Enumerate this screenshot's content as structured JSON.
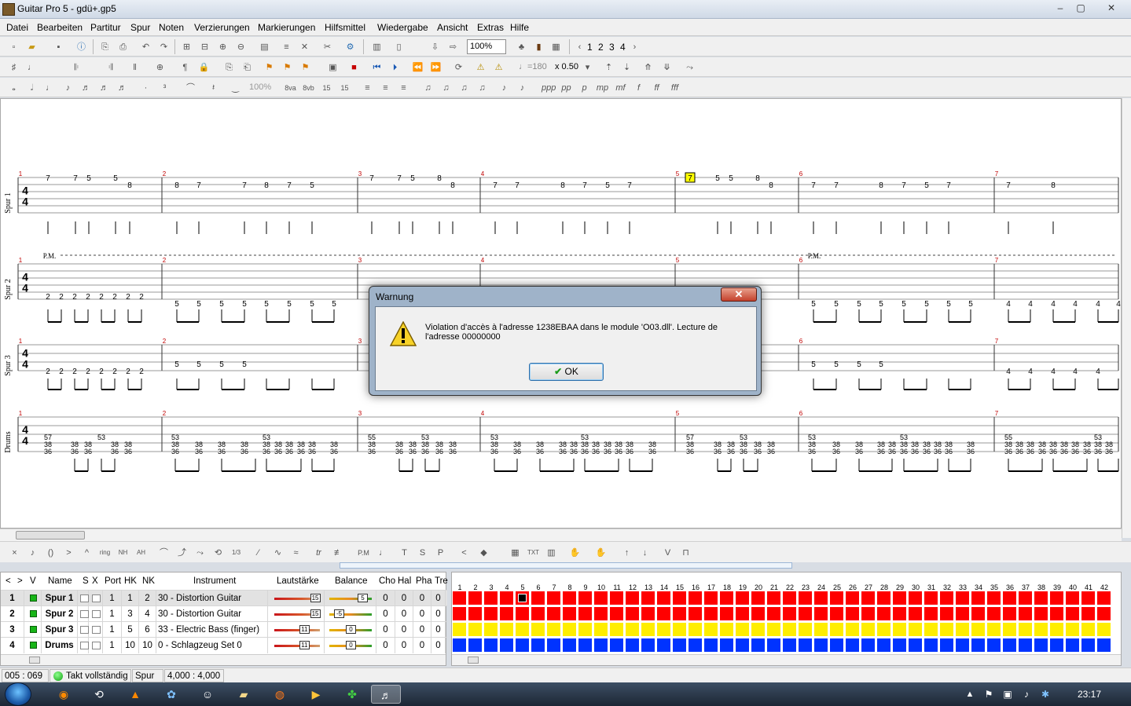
{
  "window": {
    "title": "Guitar Pro 5 - gdü+.gp5",
    "minimize": "–",
    "maximize": "▢",
    "close": "✕"
  },
  "menu": [
    "Datei",
    "Bearbeiten",
    "Partitur",
    "Spur",
    "Noten",
    "Verzierungen",
    "Markierungen",
    "Hilfsmittel",
    "Wiedergabe",
    "Ansicht",
    "Extras",
    "Hilfe"
  ],
  "toolbar": {
    "zoom": "100%",
    "pages": [
      "1",
      "2",
      "3",
      "4"
    ],
    "tempo": "♩=180",
    "speed": "x 0.50",
    "velocity_pct": "100%"
  },
  "score": {
    "tracks": [
      {
        "label": "Spur 1"
      },
      {
        "label": "Spur 2"
      },
      {
        "label": "Spur 3"
      },
      {
        "label": "Drums"
      }
    ],
    "bar_numbers": [
      "1",
      "2",
      "3",
      "4",
      "5",
      "6",
      "7"
    ],
    "pm_label": "P.M.",
    "cursor_fret": "7",
    "time_signature": "4/4",
    "spur1_frets": [
      "7",
      "7",
      "5",
      "5",
      "8",
      "8",
      "7",
      "7",
      "8",
      "7",
      "5",
      "7",
      "7",
      "5",
      "8",
      "8",
      "7",
      "7",
      "8",
      "7",
      "5",
      "7",
      "5",
      "5",
      "8",
      "8",
      "7",
      "7",
      "8",
      "7",
      "5",
      "7",
      "7",
      "8"
    ],
    "spur2_frets_bar1": [
      "2",
      "2",
      "2",
      "2",
      "2",
      "2",
      "2",
      "2"
    ],
    "spur2_frets_bar2": [
      "5",
      "5",
      "5",
      "5",
      "5",
      "5",
      "5",
      "5"
    ],
    "spur2_frets_bar7": [
      "4",
      "4",
      "4",
      "4",
      "4",
      "4",
      "4",
      "4"
    ],
    "drum_top": [
      "57",
      "53",
      "53",
      "53",
      "55",
      "53",
      "53",
      "53",
      "57",
      "53",
      "53",
      "53",
      "55",
      "53"
    ],
    "drum_mid": "38",
    "drum_low": "36"
  },
  "dialog": {
    "title": "Warnung",
    "close": "✕",
    "message": "Violation d'accès à l'adresse 1238EBAA dans le module 'O03.dll'. Lecture de l'adresse 00000000",
    "ok": "OK"
  },
  "trackpanel": {
    "headers": [
      "Name",
      "S",
      "X",
      "Port",
      "HK",
      "NK",
      "Instrument",
      "Lautstärke",
      "Balance",
      "Cho",
      "Hal",
      "Pha",
      "Tre"
    ],
    "nav_left": "<",
    "nav_right": ">",
    "v_header": "V",
    "rows": [
      {
        "num": "1",
        "name": "Spur 1",
        "port": "1",
        "hk": "1",
        "nk": "2",
        "instrument": "30 - Distortion Guitar",
        "vol": "15",
        "bal": "5",
        "cho": "0",
        "hal": "0",
        "pha": "0",
        "tre": "0",
        "color": "#ff0000"
      },
      {
        "num": "2",
        "name": "Spur 2",
        "port": "1",
        "hk": "3",
        "nk": "4",
        "instrument": "30 - Distortion Guitar",
        "vol": "15",
        "bal": "-5",
        "cho": "0",
        "hal": "0",
        "pha": "0",
        "tre": "0",
        "color": "#ff0000"
      },
      {
        "num": "3",
        "name": "Spur 3",
        "port": "1",
        "hk": "5",
        "nk": "6",
        "instrument": "33 - Electric Bass (finger)",
        "vol": "11",
        "bal": "0",
        "cho": "0",
        "hal": "0",
        "pha": "0",
        "tre": "0",
        "color": "#ffee00"
      },
      {
        "num": "4",
        "name": "Drums",
        "port": "1",
        "hk": "10",
        "nk": "10",
        "instrument": "0 - Schlagzeug Set 0",
        "vol": "11",
        "bal": "0",
        "cho": "0",
        "hal": "0",
        "pha": "0",
        "tre": "0",
        "color": "#0033ff"
      }
    ]
  },
  "bargrid": {
    "numbers": [
      "1",
      "2",
      "3",
      "4",
      "5",
      "6",
      "7",
      "8",
      "9",
      "10",
      "11",
      "12",
      "13",
      "14",
      "15",
      "16",
      "17",
      "18",
      "19",
      "20",
      "21",
      "22",
      "23",
      "24",
      "25",
      "26",
      "27",
      "28",
      "29",
      "30",
      "31",
      "32",
      "33",
      "34",
      "35",
      "36",
      "37",
      "38",
      "39",
      "40",
      "41",
      "42"
    ]
  },
  "status": {
    "position": "005 : 069",
    "measure_state": "Takt vollständig",
    "track": "Spur 1",
    "signature": "4,000 : 4,000"
  },
  "taskbar": {
    "clock": "23:17"
  }
}
